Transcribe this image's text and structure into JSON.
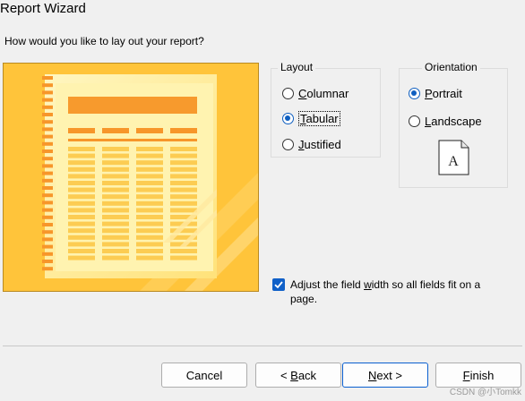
{
  "window": {
    "title": "Report Wizard"
  },
  "prompt": "How would you like to lay out your report?",
  "layout": {
    "title": "Layout",
    "options": [
      {
        "label": "Columnar",
        "mnemonic": "C",
        "rest": "olumnar",
        "checked": false
      },
      {
        "label": "Tabular",
        "mnemonic": "T",
        "rest": "abular",
        "checked": true
      },
      {
        "label": "Justified",
        "mnemonic": "J",
        "rest": "ustified",
        "checked": false
      }
    ]
  },
  "orientation": {
    "title": "Orientation",
    "options": [
      {
        "label": "Portrait",
        "mnemonic": "P",
        "rest": "ortrait",
        "checked": true
      },
      {
        "label": "Landscape",
        "mnemonic": "L",
        "rest": "andscape",
        "checked": false
      }
    ],
    "page_icon_letter": "A"
  },
  "adjust_width": {
    "checked": true,
    "label_prefix": "Adjust",
    "label_mid1": " the field ",
    "label_mnemonic": "w",
    "label_mid2": "idth so all fields fit on a",
    "label_line2": "page."
  },
  "buttons": {
    "cancel": "Cancel",
    "back": "< Back",
    "back_mnemonic": "B",
    "next": "Next >",
    "next_mnemonic": "N",
    "finish": "Finish",
    "finish_mnemonic": "F"
  },
  "watermark": "CSDN @小Tomkk",
  "colors": {
    "accent": "#0f5fc0",
    "preview_bg": "#ffc43a",
    "preview_page": "#fff0a8",
    "header_bar": "#f79a2d"
  }
}
